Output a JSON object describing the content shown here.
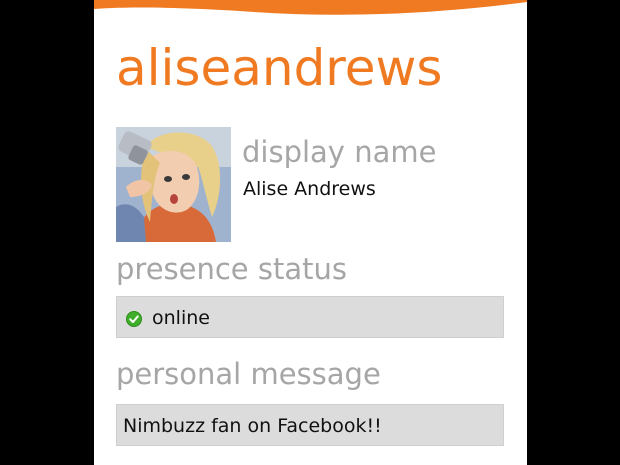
{
  "profile": {
    "username": "aliseandrews",
    "avatar_icon": "user-photo"
  },
  "fields": {
    "display_name_label": "display name",
    "display_name_value": "Alise Andrews",
    "presence_label": "presence status",
    "presence_value": "online",
    "presence_icon": "online-check-icon",
    "personal_message_label": "personal message",
    "personal_message_value": "Nimbuzz fan on Facebook!!"
  },
  "colors": {
    "accent": "#f07a21",
    "label": "#a6a6a6",
    "field_background": "#dcdcdc",
    "online_green": "#3fae2a"
  }
}
